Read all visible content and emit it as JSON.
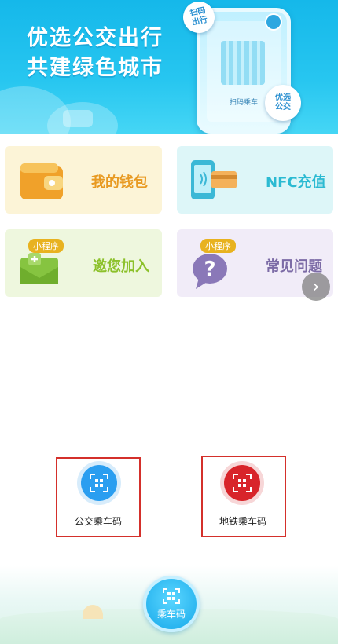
{
  "banner": {
    "title_line1": "优选公交出行",
    "title_line2": "共建绿色城市",
    "scan_sticker": "扫码\n出行",
    "phone_caption": "扫码乘车",
    "brand_sticker": "优选\n公交"
  },
  "cards": [
    {
      "label": "我的钱包",
      "color": "#e89a22",
      "bg": "#fcf4d7",
      "icon": "wallet-icon"
    },
    {
      "label": "NFC充值",
      "color": "#2bbad2",
      "bg": "#ddf6f8",
      "icon": "nfc-card-icon"
    },
    {
      "label": "邀您加入",
      "color": "#8cc12a",
      "bg": "#eef7de",
      "badge": "小程序",
      "icon": "invite-envelope-icon"
    },
    {
      "label": "常见问题",
      "color": "#7c6ba6",
      "bg": "#f1ecf8",
      "badge": "小程序",
      "icon": "help-bubble-icon"
    }
  ],
  "codes": [
    {
      "label": "公交乘车码",
      "color": "#2a9ef0",
      "icon": "bus-qr-icon"
    },
    {
      "label": "地铁乘车码",
      "color": "#d8242a",
      "icon": "metro-qr-icon"
    }
  ],
  "footer": {
    "tab_label": "乘车码"
  },
  "colors": {
    "highlight_border": "#d4302b",
    "banner_blue": "#1bbcec"
  }
}
